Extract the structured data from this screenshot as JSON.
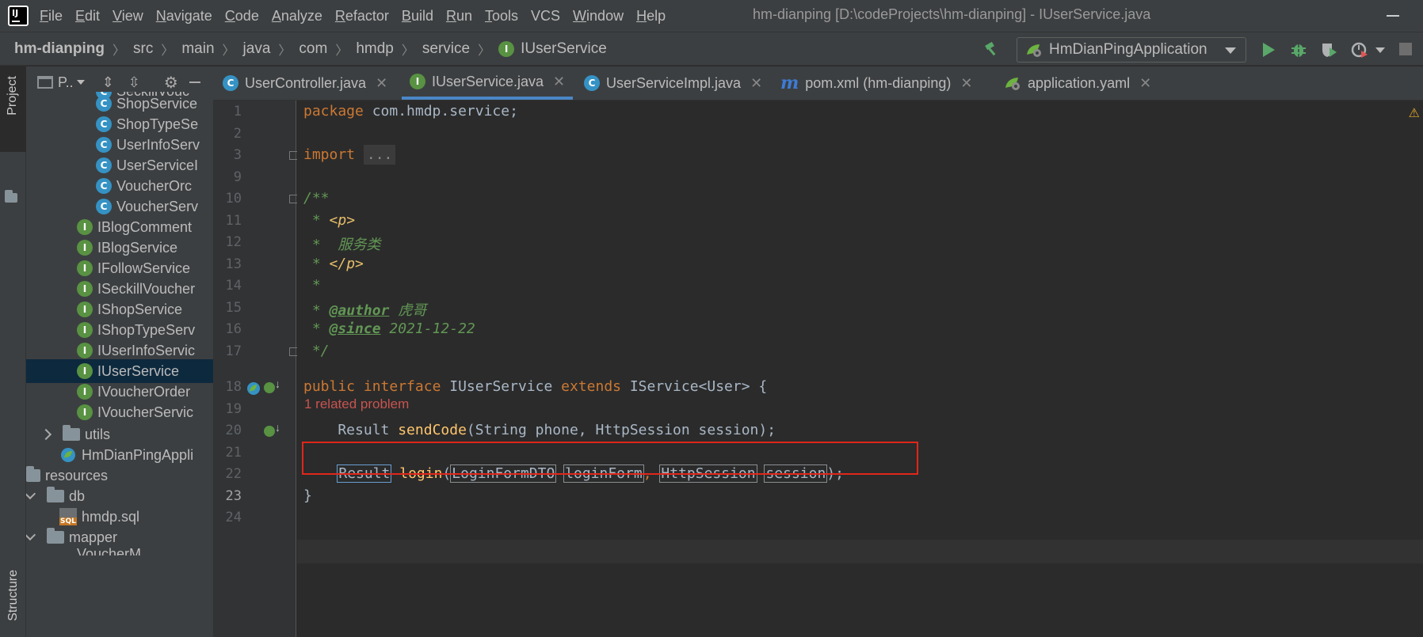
{
  "menubar": {
    "items": [
      "File",
      "Edit",
      "View",
      "Navigate",
      "Code",
      "Analyze",
      "Refactor",
      "Build",
      "Run",
      "Tools",
      "VCS",
      "Window",
      "Help"
    ],
    "window_title": "hm-dianping [D:\\codeProjects\\hm-dianping] - IUserService.java"
  },
  "navbar": {
    "breadcrumbs": [
      "hm-dianping",
      "src",
      "main",
      "java",
      "com",
      "hmdp",
      "service",
      "IUserService"
    ],
    "run_config": "HmDianPingApplication"
  },
  "left_strip": {
    "project_label": "Project",
    "structure_label": "Structure"
  },
  "project_panel": {
    "title": "P..",
    "tree": [
      {
        "label": "SeckillVouc",
        "kind": "class"
      },
      {
        "label": "ShopService",
        "kind": "class"
      },
      {
        "label": "ShopTypeSe",
        "kind": "class"
      },
      {
        "label": "UserInfoServ",
        "kind": "class"
      },
      {
        "label": "UserServiceI",
        "kind": "class"
      },
      {
        "label": "VoucherOrc",
        "kind": "class"
      },
      {
        "label": "VoucherServ",
        "kind": "class"
      },
      {
        "label": "IBlogComment",
        "kind": "interface"
      },
      {
        "label": "IBlogService",
        "kind": "interface"
      },
      {
        "label": "IFollowService",
        "kind": "interface"
      },
      {
        "label": "ISeckillVoucher",
        "kind": "interface"
      },
      {
        "label": "IShopService",
        "kind": "interface"
      },
      {
        "label": "IShopTypeServ",
        "kind": "interface"
      },
      {
        "label": "IUserInfoServic",
        "kind": "interface"
      },
      {
        "label": "IUserService",
        "kind": "interface",
        "selected": true
      },
      {
        "label": "IVoucherOrder",
        "kind": "interface"
      },
      {
        "label": "IVoucherServic",
        "kind": "interface"
      },
      {
        "label": "utils",
        "kind": "folder"
      },
      {
        "label": "HmDianPingAppli",
        "kind": "app"
      },
      {
        "label": "resources",
        "kind": "resources"
      },
      {
        "label": "db",
        "kind": "folder"
      },
      {
        "label": "hmdp.sql",
        "kind": "sql"
      },
      {
        "label": "mapper",
        "kind": "folder"
      },
      {
        "label": "VoucherM",
        "kind": "file"
      }
    ]
  },
  "tabs": [
    {
      "label": "UserController.java",
      "icon": "class-icon"
    },
    {
      "label": "IUserService.java",
      "icon": "interface-icon",
      "active": true
    },
    {
      "label": "UserServiceImpl.java",
      "icon": "class-icon"
    },
    {
      "label": "pom.xml (hm-dianping)",
      "icon": "maven-icon"
    },
    {
      "label": "application.yaml",
      "icon": "spring-icon"
    }
  ],
  "editor": {
    "line_numbers": [
      "1",
      "2",
      "3",
      "9",
      "10",
      "11",
      "12",
      "13",
      "14",
      "15",
      "16",
      "17",
      "18",
      "19",
      "20",
      "21",
      "22",
      "23",
      "24"
    ],
    "current_line": "23",
    "problem_hint": "1 related problem",
    "code": {
      "l1_kw": "package",
      "l1_rest": " com.hmdp.service;",
      "l3_kw": "import",
      "l3_fold": "...",
      "l10": "/**",
      "l11_a": " * ",
      "l11_b": "<p>",
      "l12": " *  服务类",
      "l13_a": " * ",
      "l13_b": "</p>",
      "l14": " *",
      "l15_a": " * ",
      "l15_ann": "@author",
      "l15_b": " 虎哥",
      "l16_a": " * ",
      "l16_ann": "@since",
      "l16_b": " 2021-12-22",
      "l17": " */",
      "l18_kw1": "public",
      "l18_kw2": "interface",
      "l18_name": " IUserService ",
      "l18_kw3": "extends",
      "l18_rest": " IService<User> {",
      "l20_type": "    Result ",
      "l20_fn": "sendCode",
      "l20_rest": "(String phone, HttpSession session);",
      "l22_indent": "    ",
      "l22_t1": "Result",
      "l22_fn": "login",
      "l22_t2": "LoginFormDTO",
      "l22_t3": "loginForm",
      "l22_comma": ",",
      "l22_t4": "HttpSession",
      "l22_t5": "session",
      "l22_end": ");",
      "l23": "}"
    }
  },
  "colors": {
    "keyword": "#cc7832",
    "comment": "#629755",
    "function": "#ffc66d",
    "highlight_box": "#e0261a",
    "selection": "#0d293e"
  }
}
